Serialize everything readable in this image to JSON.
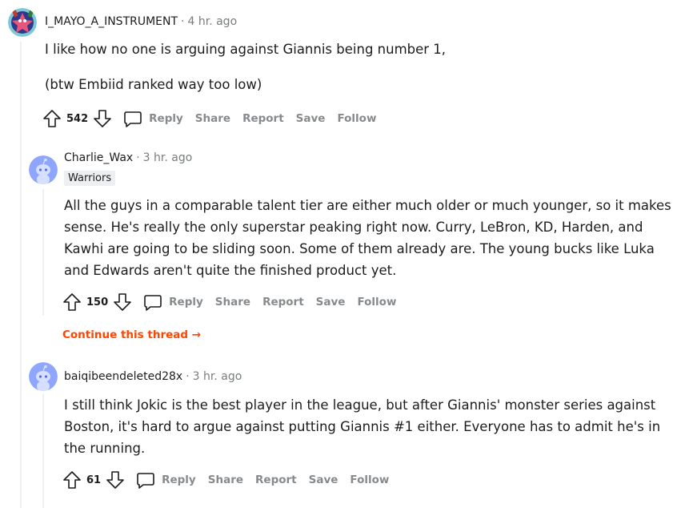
{
  "comments": [
    {
      "username": "I_MAYO_A_INSTRUMENT",
      "time": "4 hr. ago",
      "body": [
        "I like how no one is arguing against Giannis being number 1,",
        "(btw Embiid ranked way too low)"
      ],
      "score": "542",
      "avatar_icon": "patrick-star-avatar"
    },
    {
      "username": "Charlie_Wax",
      "time": "3 hr. ago",
      "flair": "Warriors",
      "body": [
        "All the guys in a comparable talent tier are either much older or much younger, so it makes sense. He's really the only superstar peaking right now. Curry, LeBron, KD, Harden, and Kawhi are going to be sliding soon. Some of them already are. The young bucks like Luka and Edwards aren't quite the finished product yet."
      ],
      "score": "150",
      "avatar_icon": "snoo-avatar"
    },
    {
      "username": "baiqibeendeleted28x",
      "time": "3 hr. ago",
      "body": [
        "I still think Jokic is the best player in the league, but after Giannis' monster series against Boston, it's hard to argue against putting Giannis #1 either. Everyone has to admit he's in the running."
      ],
      "score": "61",
      "avatar_icon": "snoo-avatar"
    }
  ],
  "actions": {
    "reply": "Reply",
    "share": "Share",
    "report": "Report",
    "save": "Save",
    "follow": "Follow"
  },
  "meta_separator": "·",
  "continue_thread": "Continue this thread →",
  "colors": {
    "accent": "#ff4500",
    "muted": "#878a8c",
    "thread_line": "#edeff1",
    "avatar_blue": "#8fa6ff"
  }
}
